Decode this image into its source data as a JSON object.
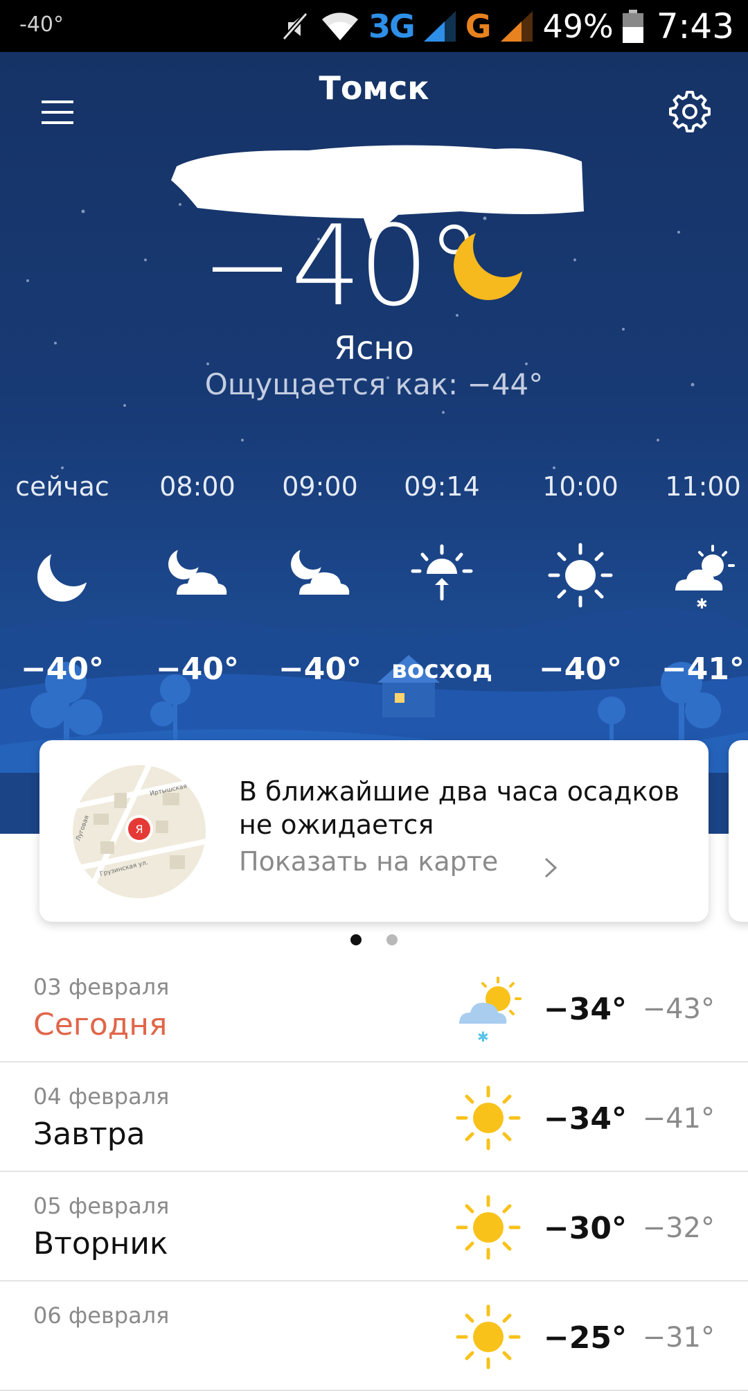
{
  "status_bar": {
    "left_temp": "-40°",
    "network_3g": "3G",
    "network_g": "G",
    "battery": "49%",
    "time": "7:43",
    "icons": [
      "mute-icon",
      "wifi-icon",
      "signal-icon",
      "signal-icon",
      "battery-icon"
    ]
  },
  "header": {
    "city": "Томск",
    "menu_icon": "hamburger-menu-icon",
    "settings_icon": "gear-icon"
  },
  "current": {
    "temp": "−40°",
    "condition": "Ясно",
    "feels_like": "Ощущается как: −44°",
    "icon": "moon-icon"
  },
  "hourly": [
    {
      "time": "сейчас",
      "icon": "moon-icon",
      "temp": "−40°"
    },
    {
      "time": "08:00",
      "icon": "moon-cloud-icon",
      "temp": "−40°"
    },
    {
      "time": "09:00",
      "icon": "moon-cloud-icon",
      "temp": "−40°"
    },
    {
      "time": "09:14",
      "icon": "sunrise-icon",
      "temp": "восход"
    },
    {
      "time": "10:00",
      "icon": "sun-icon",
      "temp": "−40°"
    },
    {
      "time": "11:00",
      "icon": "sun-cloud-snow-icon",
      "temp": "−41°"
    }
  ],
  "nowcast": {
    "text": "В ближайшие два часа осадков не ожидается",
    "link": "Показать на карте",
    "map_marker": "Я"
  },
  "pager": {
    "count": 2,
    "active": 0
  },
  "daily": [
    {
      "date": "03 февраля",
      "name": "Сегодня",
      "icon": "sun-cloud-snow-icon",
      "max": "−34°",
      "min": "−43°",
      "highlight": true
    },
    {
      "date": "04 февраля",
      "name": "Завтра",
      "icon": "sun-icon",
      "max": "−34°",
      "min": "−41°"
    },
    {
      "date": "05 февраля",
      "name": "Вторник",
      "icon": "sun-icon",
      "max": "−30°",
      "min": "−32°"
    },
    {
      "date": "06 февраля",
      "name": "",
      "icon": "sun-icon",
      "max": "−25°",
      "min": "−31°"
    }
  ],
  "colors": {
    "sky_top": "#163366",
    "sky_bottom": "#1e56a6",
    "today_accent": "#e0664a",
    "sun_yellow": "#f8c21b",
    "moon_yellow": "#f6b91e",
    "snow_blue": "#58c4e8"
  }
}
